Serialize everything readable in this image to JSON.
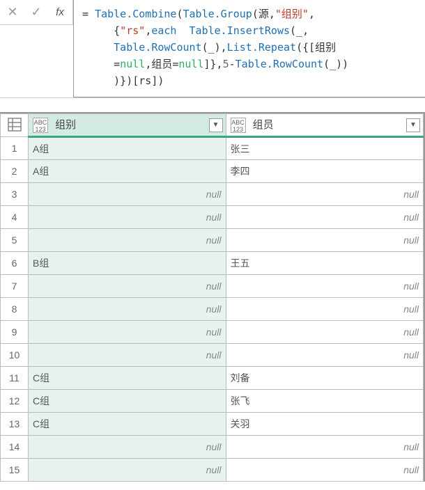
{
  "formula": {
    "eq": "=",
    "tokens": [
      {
        "t": " ",
        "c": ""
      },
      {
        "t": "Table.Combine",
        "c": "kw-blue"
      },
      {
        "t": "(",
        "c": ""
      },
      {
        "t": "Table.Group",
        "c": "kw-blue"
      },
      {
        "t": "(源,",
        "c": ""
      },
      {
        "t": "\"组别\"",
        "c": "kw-red"
      },
      {
        "t": ",\n     {",
        "c": ""
      },
      {
        "t": "\"rs\"",
        "c": "kw-red"
      },
      {
        "t": ",",
        "c": ""
      },
      {
        "t": "each",
        "c": "kw-blue"
      },
      {
        "t": "  ",
        "c": ""
      },
      {
        "t": "Table.InsertRows",
        "c": "kw-blue"
      },
      {
        "t": "(_,\n     ",
        "c": ""
      },
      {
        "t": "Table.RowCount",
        "c": "kw-blue"
      },
      {
        "t": "(_),",
        "c": ""
      },
      {
        "t": "List.Repeat",
        "c": "kw-blue"
      },
      {
        "t": "({[组别\n     =",
        "c": ""
      },
      {
        "t": "null",
        "c": "kw-green"
      },
      {
        "t": ",组员=",
        "c": ""
      },
      {
        "t": "null",
        "c": "kw-green"
      },
      {
        "t": "]},",
        "c": ""
      },
      {
        "t": "5",
        "c": "kw-gray"
      },
      {
        "t": "-",
        "c": ""
      },
      {
        "t": "Table.RowCount",
        "c": "kw-blue"
      },
      {
        "t": "(_))\n     )})[rs])",
        "c": ""
      }
    ]
  },
  "table": {
    "type_label": "ABC\n123",
    "headers": [
      "组别",
      "组员"
    ],
    "rows": [
      {
        "n": "1",
        "c1": "A组",
        "c2": "张三"
      },
      {
        "n": "2",
        "c1": "A组",
        "c2": "李四"
      },
      {
        "n": "3",
        "c1": null,
        "c2": null
      },
      {
        "n": "4",
        "c1": null,
        "c2": null
      },
      {
        "n": "5",
        "c1": null,
        "c2": null
      },
      {
        "n": "6",
        "c1": "B组",
        "c2": "王五"
      },
      {
        "n": "7",
        "c1": null,
        "c2": null
      },
      {
        "n": "8",
        "c1": null,
        "c2": null
      },
      {
        "n": "9",
        "c1": null,
        "c2": null
      },
      {
        "n": "10",
        "c1": null,
        "c2": null
      },
      {
        "n": "11",
        "c1": "C组",
        "c2": "刘备"
      },
      {
        "n": "12",
        "c1": "C组",
        "c2": "张飞"
      },
      {
        "n": "13",
        "c1": "C组",
        "c2": "关羽"
      },
      {
        "n": "14",
        "c1": null,
        "c2": null
      },
      {
        "n": "15",
        "c1": null,
        "c2": null
      }
    ],
    "null_label": "null"
  }
}
